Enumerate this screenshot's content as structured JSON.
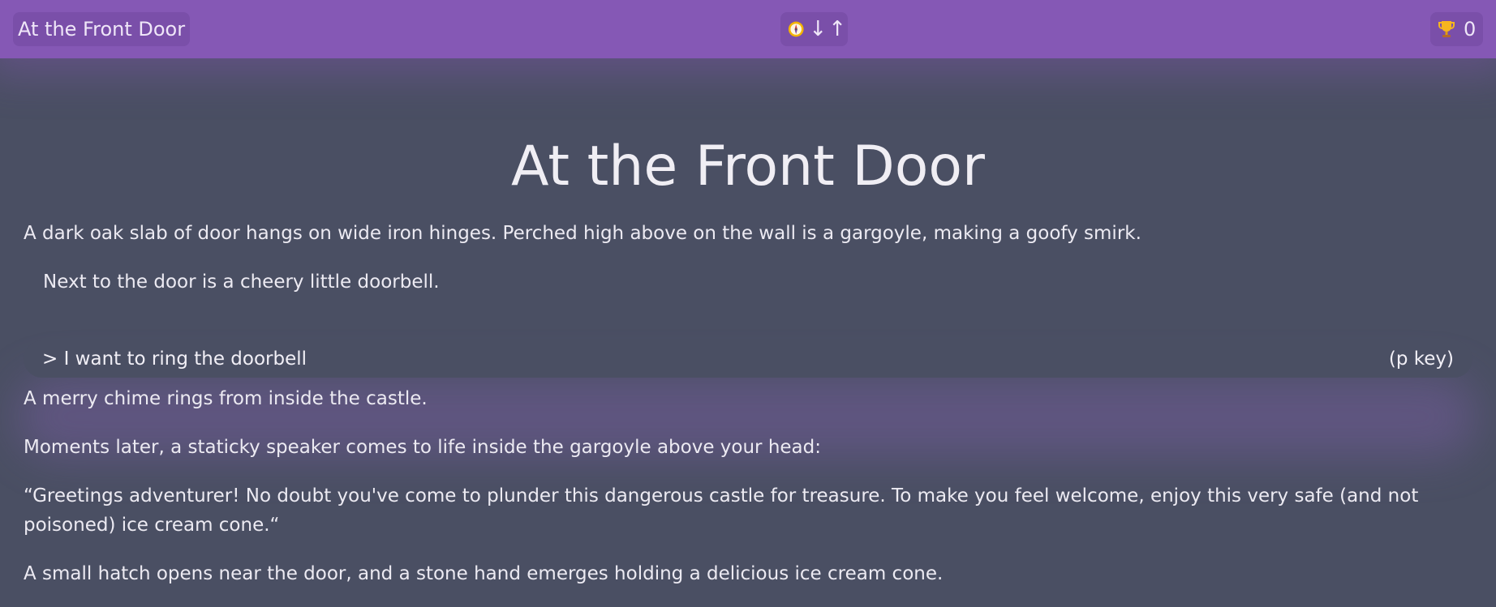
{
  "topbar": {
    "room_name": "At the Front Door",
    "nav_arrows": "↓↑",
    "nav_icon": "compass-icon",
    "score_icon": "trophy-icon",
    "score": "0"
  },
  "room": {
    "title": "At the Front Door",
    "description": "A dark oak slab of door hangs on wide iron hinges. Perched high above on the wall is a gargoyle, making a goofy smirk.",
    "extra": "Next to the door is a cheery little doorbell."
  },
  "action": {
    "label": "> I want to ring the doorbell",
    "shortcut": "(p key)"
  },
  "log": [
    "A merry chime rings from inside the castle.",
    "Moments later, a staticky speaker comes to life inside the gargoyle above your head:",
    "“Greetings adventurer! No doubt you've come to plunder this dangerous castle for treasure. To make you feel welcome, enjoy this very safe (and not poisoned) ice cream cone.“",
    "A small hatch opens near the door, and a stone hand emerges holding a delicious ice cream cone."
  ],
  "colors": {
    "topbar": "#8558b5",
    "background": "#4a4f63",
    "text": "#eceaf2"
  }
}
